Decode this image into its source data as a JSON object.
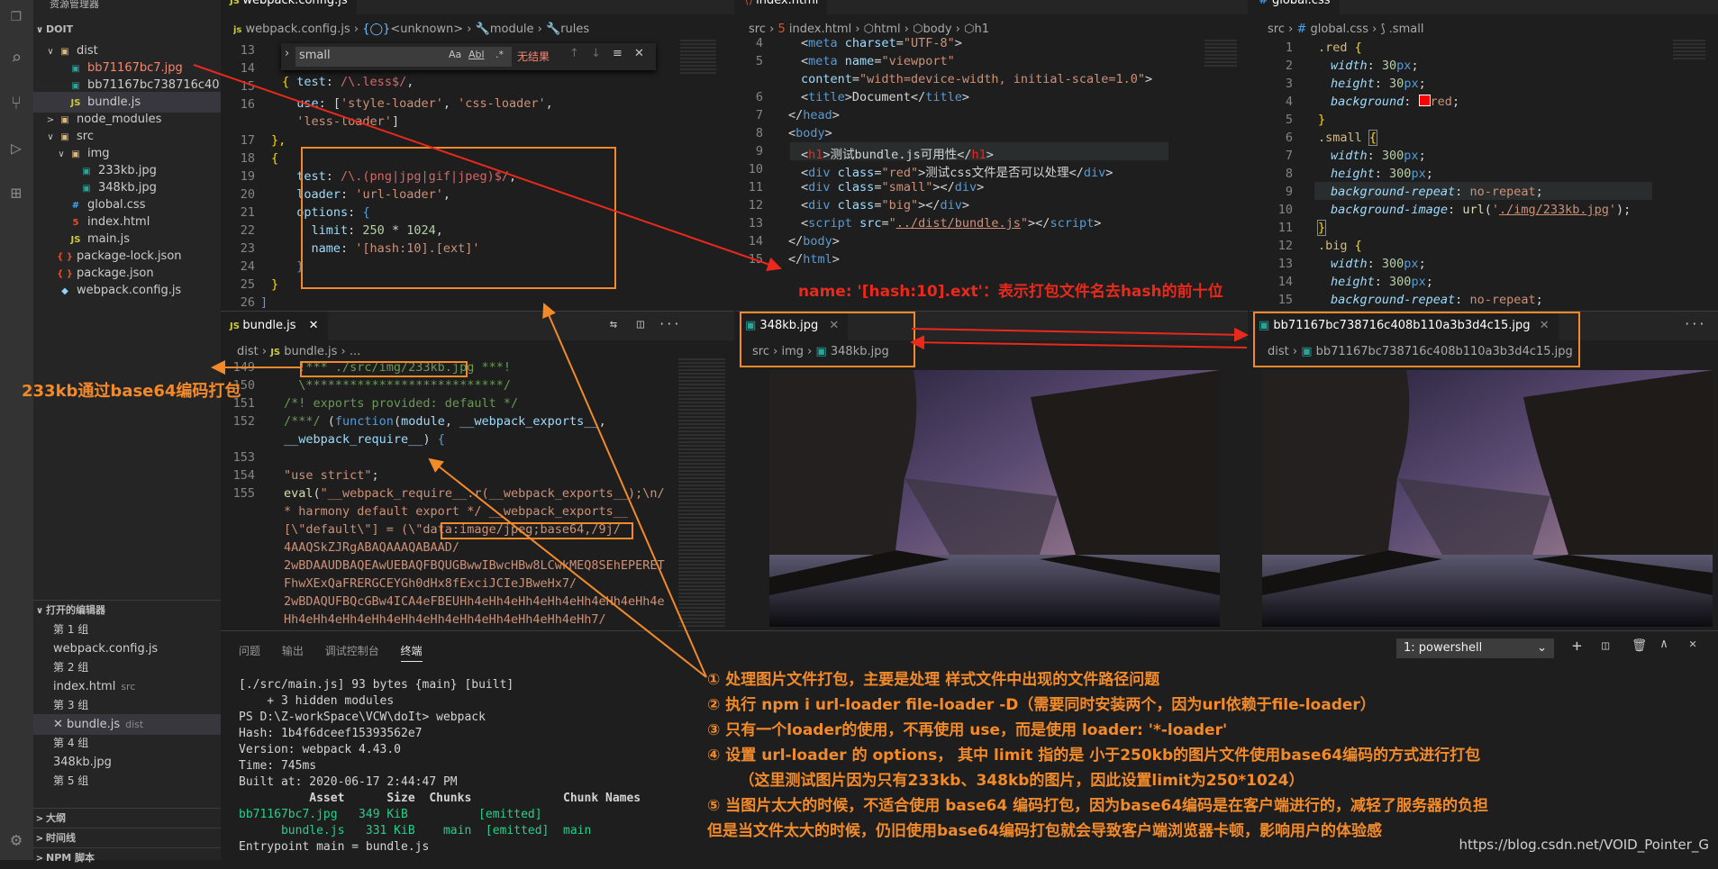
{
  "sidebar": {
    "header": "资源管理器",
    "root": "DOIT",
    "tree": [
      {
        "label": "dist",
        "icon": "folder-icon",
        "depth": 1,
        "arrow": "∨"
      },
      {
        "label": "bb71167bc7.jpg",
        "icon": "image-icon",
        "depth": 2,
        "state": "err"
      },
      {
        "label": "bb71167bc738716c40...",
        "icon": "image-icon",
        "depth": 2
      },
      {
        "label": "bundle.js",
        "icon": "js-file-icon",
        "depth": 2,
        "state": "sel"
      },
      {
        "label": "node_modules",
        "icon": "folder-icon",
        "depth": 1,
        "arrow": ">"
      },
      {
        "label": "src",
        "icon": "folder-icon",
        "depth": 1,
        "arrow": "∨"
      },
      {
        "label": "img",
        "icon": "folder-icon",
        "depth": 2,
        "arrow": "∨"
      },
      {
        "label": "233kb.jpg",
        "icon": "image-icon",
        "depth": 3
      },
      {
        "label": "348kb.jpg",
        "icon": "image-icon",
        "depth": 3
      },
      {
        "label": "global.css",
        "icon": "css-file-icon",
        "depth": 2
      },
      {
        "label": "index.html",
        "icon": "html-file-icon",
        "depth": 2
      },
      {
        "label": "main.js",
        "icon": "js-file-icon",
        "depth": 2
      },
      {
        "label": "package-lock.json",
        "icon": "json-file-icon",
        "depth": 1
      },
      {
        "label": "package.json",
        "icon": "json-file-icon",
        "depth": 1
      },
      {
        "label": "webpack.config.js",
        "icon": "webpack-icon",
        "depth": 1
      }
    ],
    "open_editors_header": "打开的编辑器",
    "open_editors": [
      {
        "group": "第 1 组",
        "file": "webpack.config.js",
        "hint": ""
      },
      {
        "group": "第 2 组",
        "file": "index.html",
        "hint": "src"
      },
      {
        "group": "第 3 组",
        "file": "bundle.js",
        "hint": "dist"
      },
      {
        "group": "第 4 组",
        "file": "348kb.jpg",
        "hint": ""
      },
      {
        "group": "第 5 组",
        "file": "",
        "hint": ""
      }
    ],
    "outline": "大纲",
    "timeline": "时间线",
    "npm": "NPM 脚本"
  },
  "editors": {
    "webpack": {
      "tab": "webpack.config.js",
      "breadcrumb": [
        "js",
        "webpack.config.js",
        "<unknown>",
        "module",
        "rules"
      ],
      "find": {
        "value": "small",
        "result": "无结果",
        "opt1": "Aa",
        "opt2": "Abl",
        "opt3": ".*"
      },
      "lines": [
        "13",
        "14",
        "15",
        "16",
        "",
        "17",
        "18",
        "19",
        "20",
        "21",
        "22",
        "23",
        "24",
        "25",
        "26"
      ]
    },
    "index": {
      "tab": "index.html",
      "breadcrumb": [
        "src",
        "index.html",
        "html",
        "body",
        "h1"
      ],
      "lines": [
        "4",
        "5",
        "",
        "6",
        "7",
        "8",
        "9",
        "10",
        "11",
        "12",
        "13",
        "14",
        "15"
      ]
    },
    "global": {
      "tab": "global.css",
      "breadcrumb": [
        "src",
        "global.css",
        ".small"
      ],
      "lines": [
        "1",
        "2",
        "3",
        "4",
        "5",
        "6",
        "7",
        "8",
        "9",
        "10",
        "11",
        "12",
        "13",
        "14",
        "15"
      ]
    },
    "bundle": {
      "tab": "bundle.js",
      "breadcrumb": [
        "dist",
        "JS",
        "bundle.js",
        "..."
      ],
      "lines": [
        "149",
        "150",
        "151",
        "152",
        "",
        "153",
        "154",
        "155"
      ]
    },
    "img348": {
      "tab": "348kb.jpg",
      "breadcrumb": [
        "src",
        "img",
        "348kb.jpg"
      ]
    },
    "imgHash": {
      "tab": "bb71167bc738716c408b110a3b3d4c15.jpg",
      "breadcrumb": [
        "dist",
        "bb71167bc738716c408b110a3b3d4c15.jpg"
      ]
    }
  },
  "panel": {
    "tabs": [
      "问题",
      "输出",
      "调试控制台",
      "终端"
    ],
    "shell": "1: powershell",
    "lines": [
      "[./src/main.js] 93 bytes {main} [built]",
      "    + 3 hidden modules",
      "PS D:\\Z-workSpace\\VCW\\doIt> webpack",
      "Hash: 1b4f6dceef15393562e7",
      "Version: webpack 4.43.0",
      "Time: 745ms",
      "Built at: 2020-06-17 2:44:47 PM",
      "          Asset      Size  Chunks             Chunk Names",
      "bb71167bc7.jpg   349 KiB          [emitted]",
      "      bundle.js   331 KiB    main  [emitted]  main",
      "Entrypoint main = bundle.js"
    ]
  },
  "annotations": {
    "top_red": "name: '[hash:10].ext'：表示打包文件名去hash的前十位",
    "left_note": "233kb通过base64编码打包",
    "notes": [
      "① 处理图片文件打包，主要是处理 样式文件中出现的文件路径问题",
      "② 执行 npm i url-loader file-loader -D（需要同时安装两个，因为url依赖于file-loader）",
      "③ 只有一个loader的使用，不再使用 use，而是使用 loader: '*-loader'",
      "④ 设置 url-loader 的 options， 其中 limit 指的是 小于250kb的图片文件使用base64编码的方式进行打包",
      "      （这里测试图片因为只有233kb、348kb的图片，因此设置limit为250*1024）",
      "⑤ 当图片太大的时候，不适合使用 base64 编码打包，因为base64编码是在客户端进行的，减轻了服务器的负担",
      "但是当文件太大的时候，仍旧使用base64编码打包就会导致客户端浏览器卡顿，影响用户的体验感"
    ],
    "watermark": "https://blog.csdn.net/VOID_Pointer_G"
  },
  "colors": {
    "accent": "#f28a2a",
    "error_red": "#e8291c",
    "editor_bg": "#1e1e1e"
  }
}
